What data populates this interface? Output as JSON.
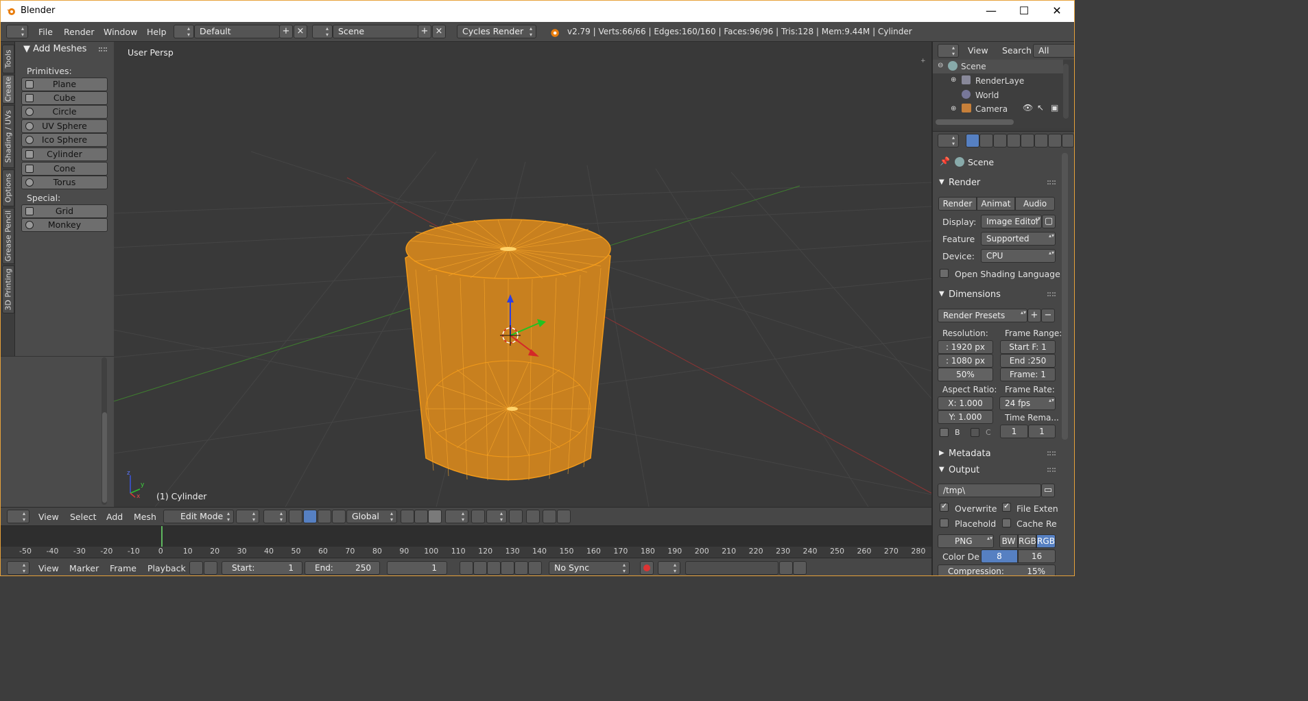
{
  "window": {
    "title": "Blender",
    "minimize": "—",
    "maximize": "☐",
    "close": "✕"
  },
  "infobar": {
    "menus": [
      "File",
      "Render",
      "Window",
      "Help"
    ],
    "layout": "Default",
    "scene": "Scene",
    "engine": "Cycles Render",
    "stats": "v2.79 | Verts:66/66 | Edges:160/160 | Faces:96/96 | Tris:128 | Mem:9.44M | Cylinder"
  },
  "vtabs": [
    "Tools",
    "Create",
    "Shading / UVs",
    "Options",
    "Grease Pencil",
    "3D Printing"
  ],
  "toolshelf": {
    "panel_title": "Add Meshes",
    "primitives_label": "Primitives:",
    "primitives": [
      "Plane",
      "Cube",
      "Circle",
      "UV Sphere",
      "Ico Sphere",
      "Cylinder",
      "Cone",
      "Torus"
    ],
    "special_label": "Special:",
    "special": [
      "Grid",
      "Monkey"
    ]
  },
  "viewport": {
    "view_name": "User Persp",
    "object_label": "(1) Cylinder",
    "axis_x": "x",
    "axis_y": "y",
    "axis_z": "z"
  },
  "v3dheader": {
    "menus": [
      "View",
      "Select",
      "Add",
      "Mesh"
    ],
    "mode": "Edit Mode",
    "orientation": "Global"
  },
  "timeline": {
    "ticks": [
      "-50",
      "-40",
      "-30",
      "-20",
      "-10",
      "0",
      "10",
      "20",
      "30",
      "40",
      "50",
      "60",
      "70",
      "80",
      "90",
      "100",
      "110",
      "120",
      "130",
      "140",
      "150",
      "160",
      "170",
      "180",
      "190",
      "200",
      "210",
      "220",
      "230",
      "240",
      "250",
      "260",
      "270",
      "280"
    ],
    "current_frame_marker": 0
  },
  "tlheader": {
    "menus": [
      "View",
      "Marker",
      "Frame",
      "Playback"
    ],
    "start_label": "Start:",
    "start": "1",
    "end_label": "End:",
    "end": "250",
    "current": "1",
    "sync": "No Sync"
  },
  "outliner": {
    "menus": [
      "View",
      "Search"
    ],
    "filter": "All Scenes",
    "items": [
      "Scene",
      "RenderLaye",
      "World",
      "Camera"
    ]
  },
  "properties": {
    "context": "Scene",
    "render": {
      "title": "Render",
      "buttons": [
        "Render",
        "Animat",
        "Audio"
      ],
      "display_label": "Display:",
      "display": "Image Editor",
      "feature_label": "Feature",
      "feature": "Supported",
      "device_label": "Device:",
      "device": "CPU",
      "osl_label": "Open Shading Language"
    },
    "dimensions": {
      "title": "Dimensions",
      "presets": "Render Presets",
      "resolution_label": "Resolution:",
      "res_x": ": 1920 px",
      "res_y": ": 1080 px",
      "res_pct": "50%",
      "frame_range_label": "Frame Range:",
      "start": "Start F: 1",
      "end": "End :250",
      "frame": "Frame: 1",
      "aspect_label": "Aspect Ratio:",
      "aspect_x": "X:  1.000",
      "aspect_y": "Y:  1.000",
      "frame_rate_label": "Frame Rate:",
      "fps": "24 fps",
      "time_remap_label": "Time Rema...",
      "remap_old": "1",
      "remap_new": "1",
      "border_label": "B",
      "crop_label": "C"
    },
    "metadata": {
      "title": "Metadata"
    },
    "output": {
      "title": "Output",
      "path": "/tmp\\",
      "overwrite": "Overwrite",
      "file_ext": "File Exten",
      "placeholders": "Placehold",
      "cache": "Cache Re",
      "format": "PNG",
      "bw": "BW",
      "rgb": "RGB",
      "rgba": "RGB",
      "color_depth_label": "Color De",
      "depth_8": "8",
      "depth_16": "16",
      "compression_label": "Compression:",
      "compression": "15%"
    }
  }
}
